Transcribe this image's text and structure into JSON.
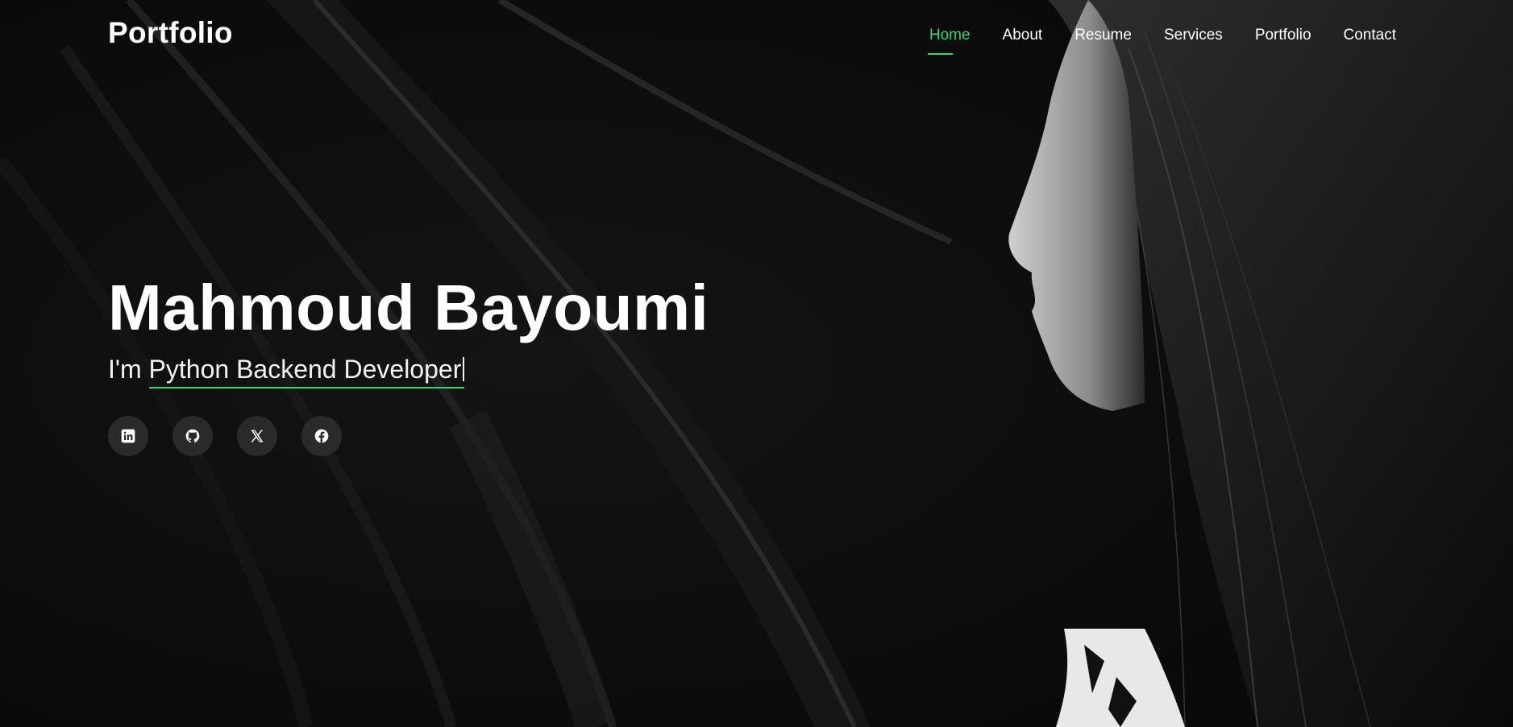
{
  "brand": {
    "logo": "Portfolio"
  },
  "nav": {
    "items": [
      {
        "label": "Home",
        "active": true
      },
      {
        "label": "About",
        "active": false
      },
      {
        "label": "Resume",
        "active": false
      },
      {
        "label": "Services",
        "active": false
      },
      {
        "label": "Portfolio",
        "active": false
      },
      {
        "label": "Contact",
        "active": false
      }
    ]
  },
  "hero": {
    "name": "Mahmoud Bayoumi",
    "prefix": "I'm",
    "typed_role": "Python Backend Developer"
  },
  "social": [
    {
      "icon": "linkedin-icon"
    },
    {
      "icon": "github-icon"
    },
    {
      "icon": "x-twitter-icon"
    },
    {
      "icon": "facebook-icon"
    }
  ],
  "colors": {
    "accent": "#2fd67a",
    "background": "#0b0b0b",
    "text": "#ffffff",
    "social_bg": "#2a2a2a"
  }
}
